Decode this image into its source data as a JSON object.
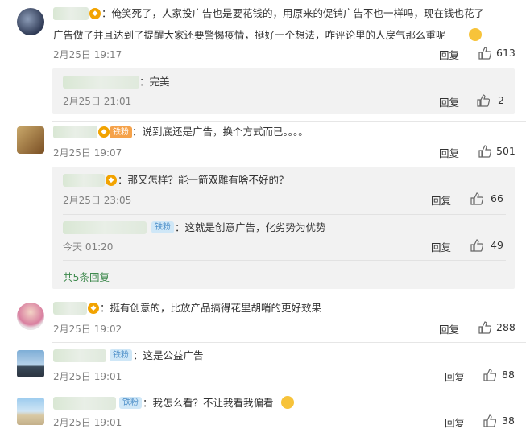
{
  "comments": [
    {
      "id": "c1",
      "text1": "：俺笑死了，人家投广告也是要花钱的，用原来的促销广告不也一样吗，现在钱也花了",
      "text2": "广告做了并且达到了提醒大家还要警惕疫情，挺好一个想法，咋评论里的人戾气那么重呢",
      "time": "2月25日 19:17",
      "reply": "回复",
      "likes": "613",
      "subreplies": [
        {
          "text": "：完美",
          "time": "2月25日 21:01",
          "reply": "回复",
          "likes": "2"
        }
      ]
    },
    {
      "id": "c2",
      "badge": "铁粉",
      "text": "：说到底还是广告，换个方式而已。。。。",
      "time": "2月25日 19:07",
      "reply": "回复",
      "likes": "501",
      "subreplies": [
        {
          "text": "：那又怎样？能一箭双雕有啥不好的？",
          "time": "2月25日 23:05",
          "reply": "回复",
          "likes": "66"
        },
        {
          "badge": "铁粉",
          "text": "：这就是创意广告，化劣势为优势",
          "time": "今天 01:20",
          "reply": "回复",
          "likes": "49"
        }
      ],
      "more": "共5条回复"
    },
    {
      "id": "c3",
      "text": "：挺有创意的，比放产品搞得花里胡哨的更好效果",
      "time": "2月25日 19:02",
      "reply": "回复",
      "likes": "288"
    },
    {
      "id": "c4",
      "badge": "铁粉",
      "text": "：这是公益广告",
      "time": "2月25日 19:01",
      "reply": "回复",
      "likes": "88"
    },
    {
      "id": "c5",
      "badge": "铁粉",
      "text": "：我怎么看？不让我看我偏看",
      "time": "2月25日 19:01",
      "reply": "回复",
      "likes": "38"
    }
  ],
  "colors": {
    "more_link": "#3f8a4e",
    "fan_badge_bg": "#cfe7f7",
    "fan_badge_text": "#4f90c9",
    "panel_bg": "#f2f2f2"
  }
}
